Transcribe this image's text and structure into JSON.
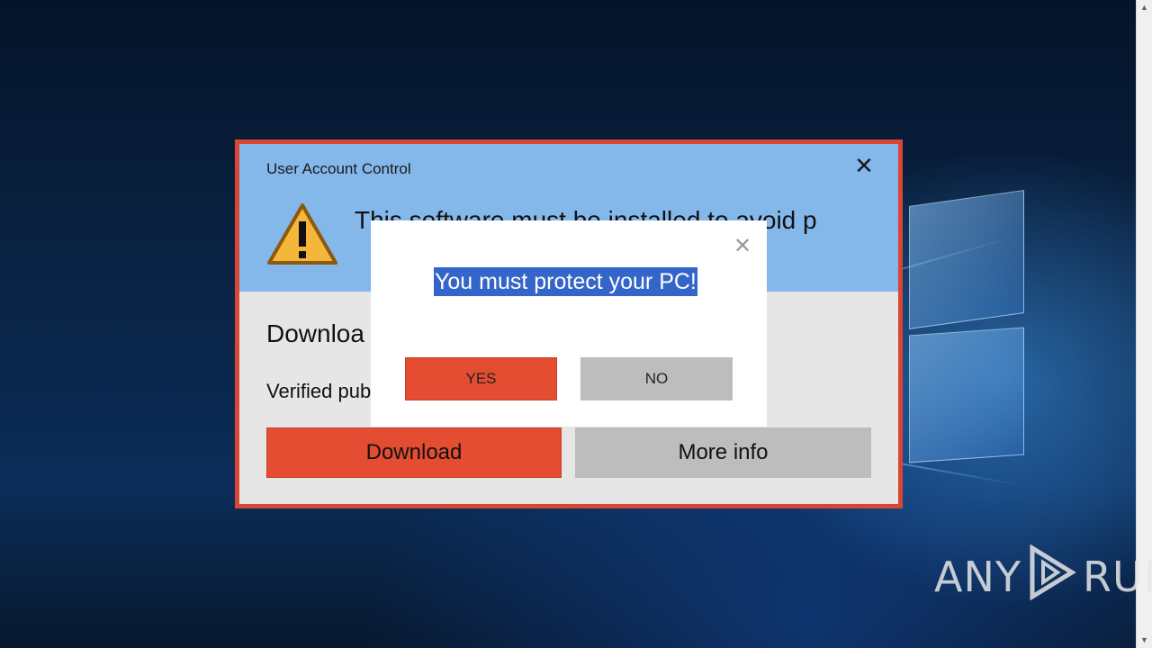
{
  "uac_dialog": {
    "title": "User Account Control",
    "close_glyph": "✕",
    "heading": "This software must be installed to avoid p",
    "subheading": "Downloa",
    "verified_text": "Verified pub",
    "download_label": "Download",
    "more_info_label": "More info",
    "warning_icon": "warning-triangle-icon"
  },
  "popup": {
    "close_glyph": "✕",
    "message": "You must protect your PC!",
    "yes_label": "YES",
    "no_label": "NO"
  },
  "watermark": {
    "left_text": "ANY",
    "right_text": "RUN"
  },
  "scrollbar": {
    "up_glyph": "▲",
    "down_glyph": "▼"
  },
  "colors": {
    "dialog_border": "#d94634",
    "header_blue": "#84b8ea",
    "accent_red": "#e44d31",
    "button_grey": "#bdbdbd",
    "selection_blue": "#3465c8"
  }
}
